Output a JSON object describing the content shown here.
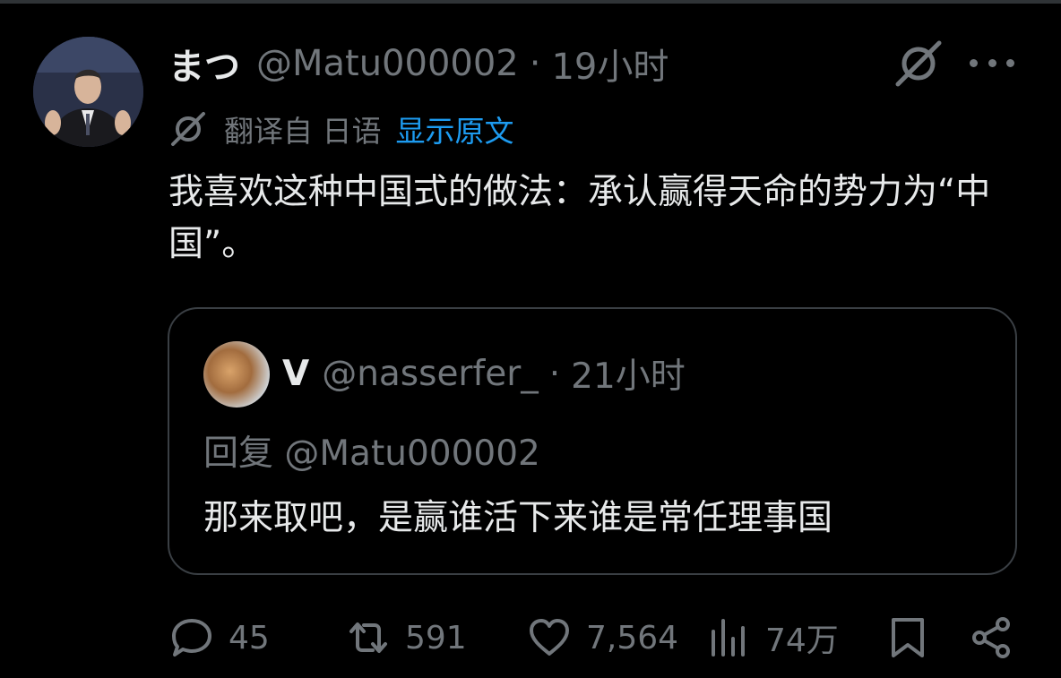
{
  "tweet": {
    "display_name": "まつ",
    "handle": "@Matu000002",
    "separator": "·",
    "time": "19小时",
    "translated_from": "翻译自 日语",
    "show_original": "显示原文",
    "text": "我喜欢这种中国式的做法：承认赢得天命的势力为“中国”。"
  },
  "quote": {
    "display_name": "V",
    "handle": "@nasserfer_",
    "separator": "·",
    "time": "21小时",
    "reply_to": "回复 @Matu000002",
    "text": "那来取吧，是赢谁活下来谁是常任理事国"
  },
  "actions": {
    "replies": "45",
    "reposts": "591",
    "likes": "7,564",
    "views": "74万"
  },
  "icons": {
    "reply": "speech-bubble-icon",
    "repost": "repost-arrows-icon",
    "like": "heart-icon",
    "views": "bar-chart-icon",
    "bookmark": "bookmark-icon",
    "share": "share-nodes-icon",
    "grok": "grok-slash-icon",
    "more": "more-dots-icon"
  },
  "colors": {
    "background": "#000000",
    "text": "#e7e9ea",
    "secondary": "#71767b",
    "link": "#1d9bf0",
    "border": "#3a3f44"
  }
}
